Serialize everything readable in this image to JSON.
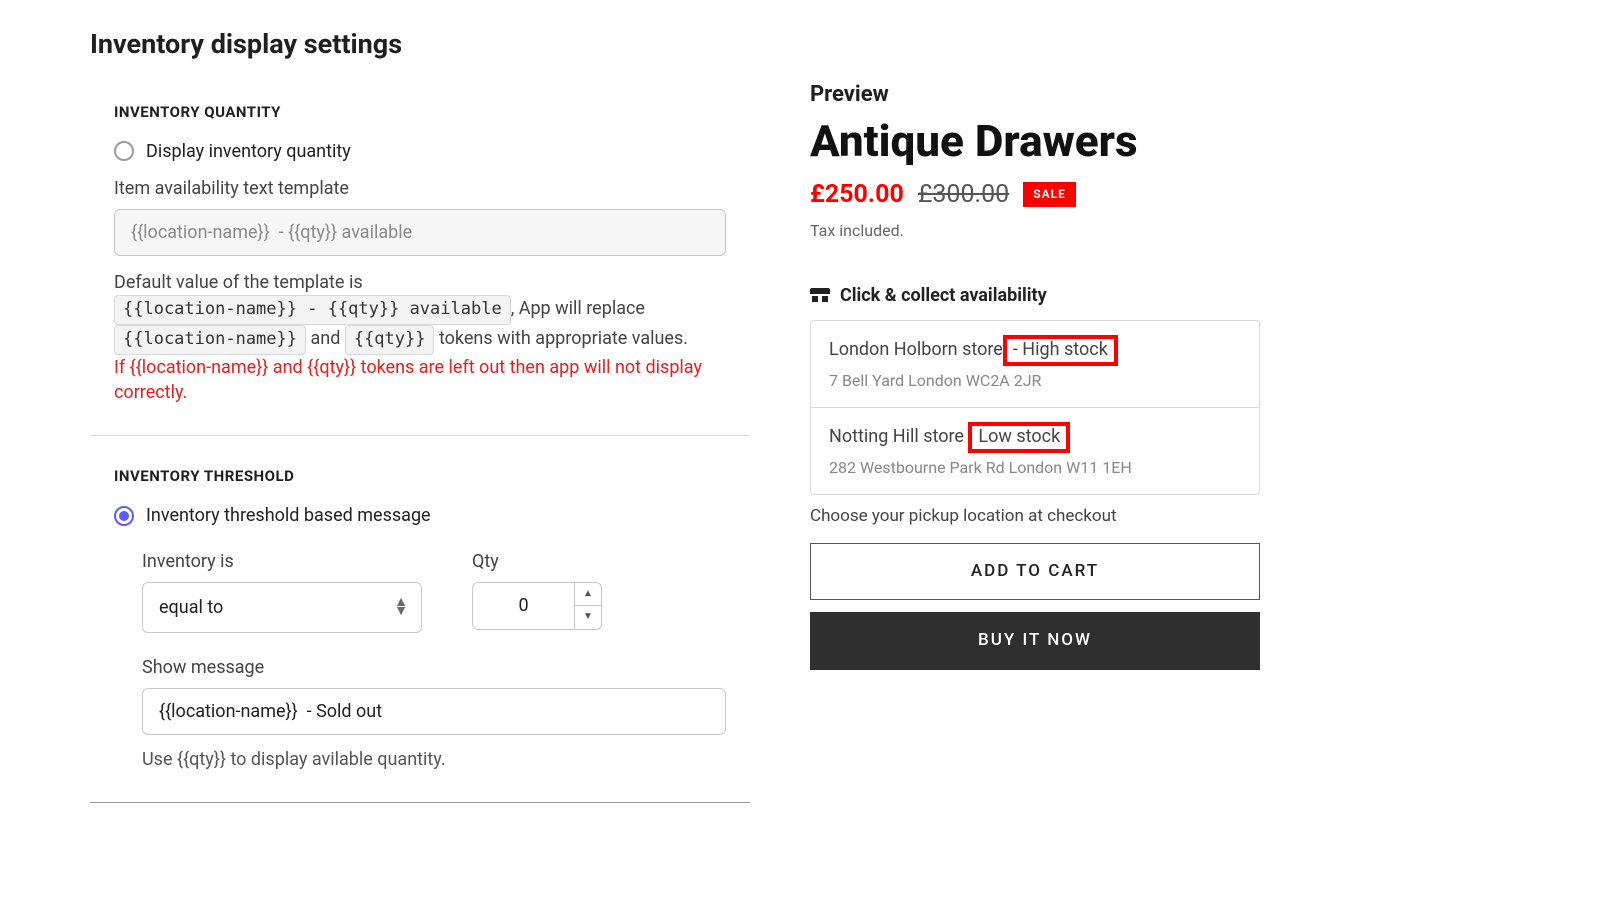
{
  "page": {
    "title": "Inventory display settings"
  },
  "quantity": {
    "header": "INVENTORY QUANTITY",
    "radio_label": "Display inventory quantity",
    "template_label": "Item availability text template",
    "template_value": "{{location-name}}  - {{qty}} available",
    "hint_prefix": "Default value of the template is",
    "hint_default_template": "{{location-name}} - {{qty}} available",
    "hint_mid": ", App will replace",
    "token_loc": "{{location-name}}",
    "hint_and": "and",
    "token_qty": "{{qty}}",
    "hint_suffix": " tokens with appropriate values.",
    "warn": "If {{location-name}} and {{qty}} tokens are left out then app will not display correctly."
  },
  "threshold": {
    "header": "INVENTORY THRESHOLD",
    "radio_label": "Inventory threshold based message",
    "inventory_is_label": "Inventory is",
    "operator": "equal to",
    "qty_label": "Qty",
    "qty_value": "0",
    "show_message_label": "Show message",
    "show_message_value": "{{location-name}}  - Sold out",
    "use_prefix": "Use ",
    "use_token": "{{qty}}",
    "use_suffix": " to display avilable quantity."
  },
  "preview": {
    "label": "Preview",
    "product_title": "Antique Drawers",
    "sale_price": "£250.00",
    "orig_price": "£300.00",
    "sale_badge": "SALE",
    "tax_note": "Tax included.",
    "avail_header": "Click & collect availability",
    "stores": [
      {
        "name": "London Holborn store",
        "status_prefix": " - ",
        "status": "High stock",
        "address": "7 Bell Yard London WC2A 2JR"
      },
      {
        "name": "Notting Hill store ",
        "status_prefix": "",
        "status": "Low stock",
        "address": "282 Westbourne Park Rd London W11 1EH"
      }
    ],
    "pickup_note": "Choose your pickup location at checkout",
    "add_to_cart": "ADD TO CART",
    "buy_now": "BUY IT NOW"
  }
}
